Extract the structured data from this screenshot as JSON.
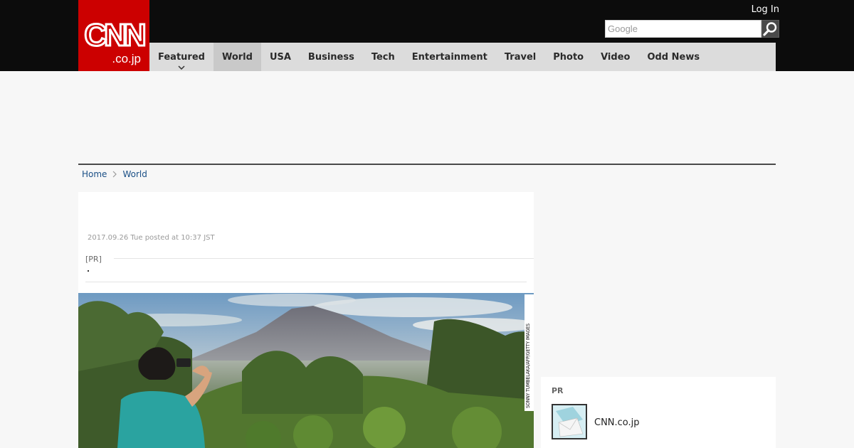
{
  "header": {
    "logo_text": "CNN",
    "logo_sub": ".co.jp",
    "login_label": "Log In",
    "search_placeholder": "Google",
    "colors": {
      "logo_bg": "#cc0000",
      "topbar_bg": "#0c0c0c",
      "nav_bg": "#dcdcdc"
    }
  },
  "nav": {
    "items": [
      {
        "label": "Featured"
      },
      {
        "label": "World"
      },
      {
        "label": "USA"
      },
      {
        "label": "Business"
      },
      {
        "label": "Tech"
      },
      {
        "label": "Entertainment"
      },
      {
        "label": "Travel"
      },
      {
        "label": "Photo"
      },
      {
        "label": "Video"
      },
      {
        "label": "Odd News"
      }
    ],
    "active": "World"
  },
  "breadcrumb": {
    "home": "Home",
    "current": "World"
  },
  "article": {
    "posted": "2017.09.26 Tue posted at 10:37 JST",
    "pr_label": "[PR]",
    "photo_credit": "SONNY TUMBELAKA/AFP/GETTY IMAGES"
  },
  "sidebar": {
    "pr_heading": "PR",
    "item_title": "CNN.co.jp"
  },
  "icons": {
    "search": "search-icon",
    "chevron": "chevron-down-icon",
    "breadcrumb_sep": "chevron-right-icon"
  }
}
